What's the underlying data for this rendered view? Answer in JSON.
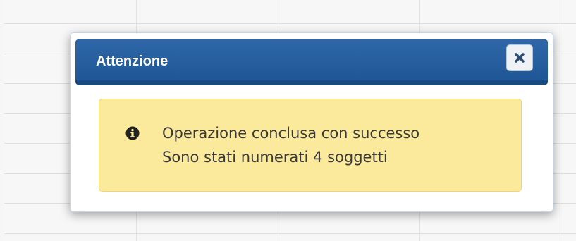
{
  "dialog": {
    "title": "Attenzione",
    "close_icon": "close-icon",
    "message": {
      "icon": "info-icon",
      "line1": "Operazione conclusa con successo",
      "line2": "Sono stati numerati 4 soggetti"
    }
  },
  "colors": {
    "header_bg": "#2e67a8",
    "alert_bg": "#fbe99c",
    "alert_border": "#f0d670",
    "text": "#3a3a3a"
  }
}
